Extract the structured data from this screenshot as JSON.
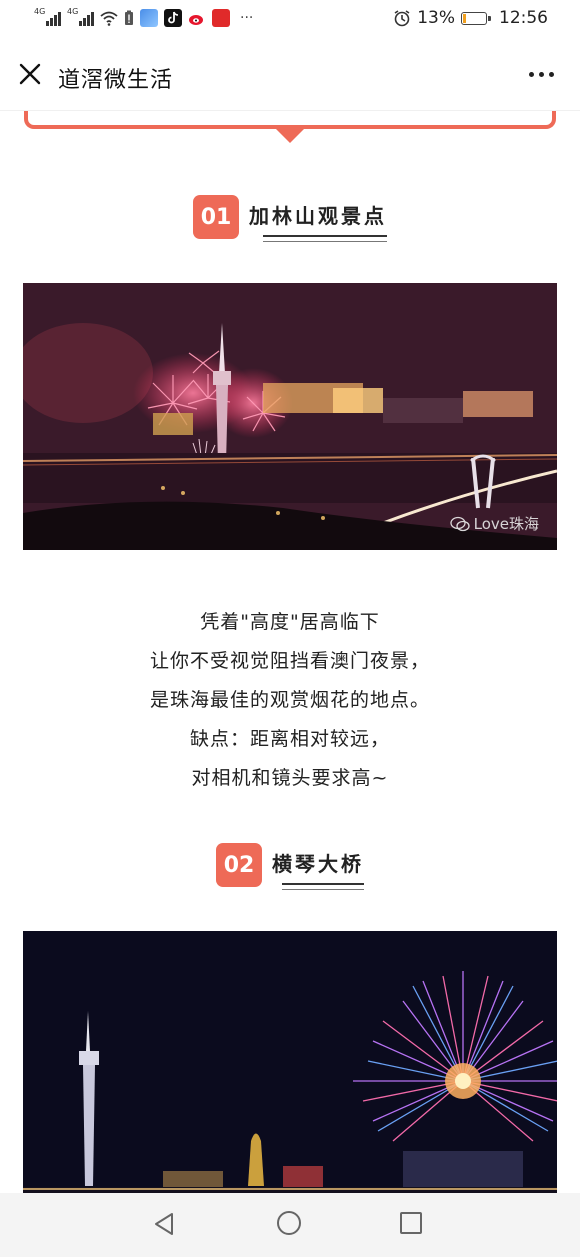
{
  "status_bar": {
    "net1": "4G",
    "net2": "4G",
    "battery_percent_text": "13%",
    "battery_level": 0.13,
    "time": "12:56",
    "more": "···"
  },
  "title_bar": {
    "title": "道滘微生活"
  },
  "sections": [
    {
      "number": "01",
      "title": "加林山观景点"
    },
    {
      "number": "02",
      "title": "横琴大桥"
    }
  ],
  "description": [
    "凭着\"高度\"居高临下",
    "让你不受视觉阻挡看澳门夜景，",
    "是珠海最佳的观赏烟花的地点。",
    "缺点：距离相对较远，",
    "对相机和镜头要求高~"
  ],
  "photo1_watermark": "Love珠海",
  "colors": {
    "accent": "#ee6a57",
    "battery_fill": "#f0a020"
  }
}
